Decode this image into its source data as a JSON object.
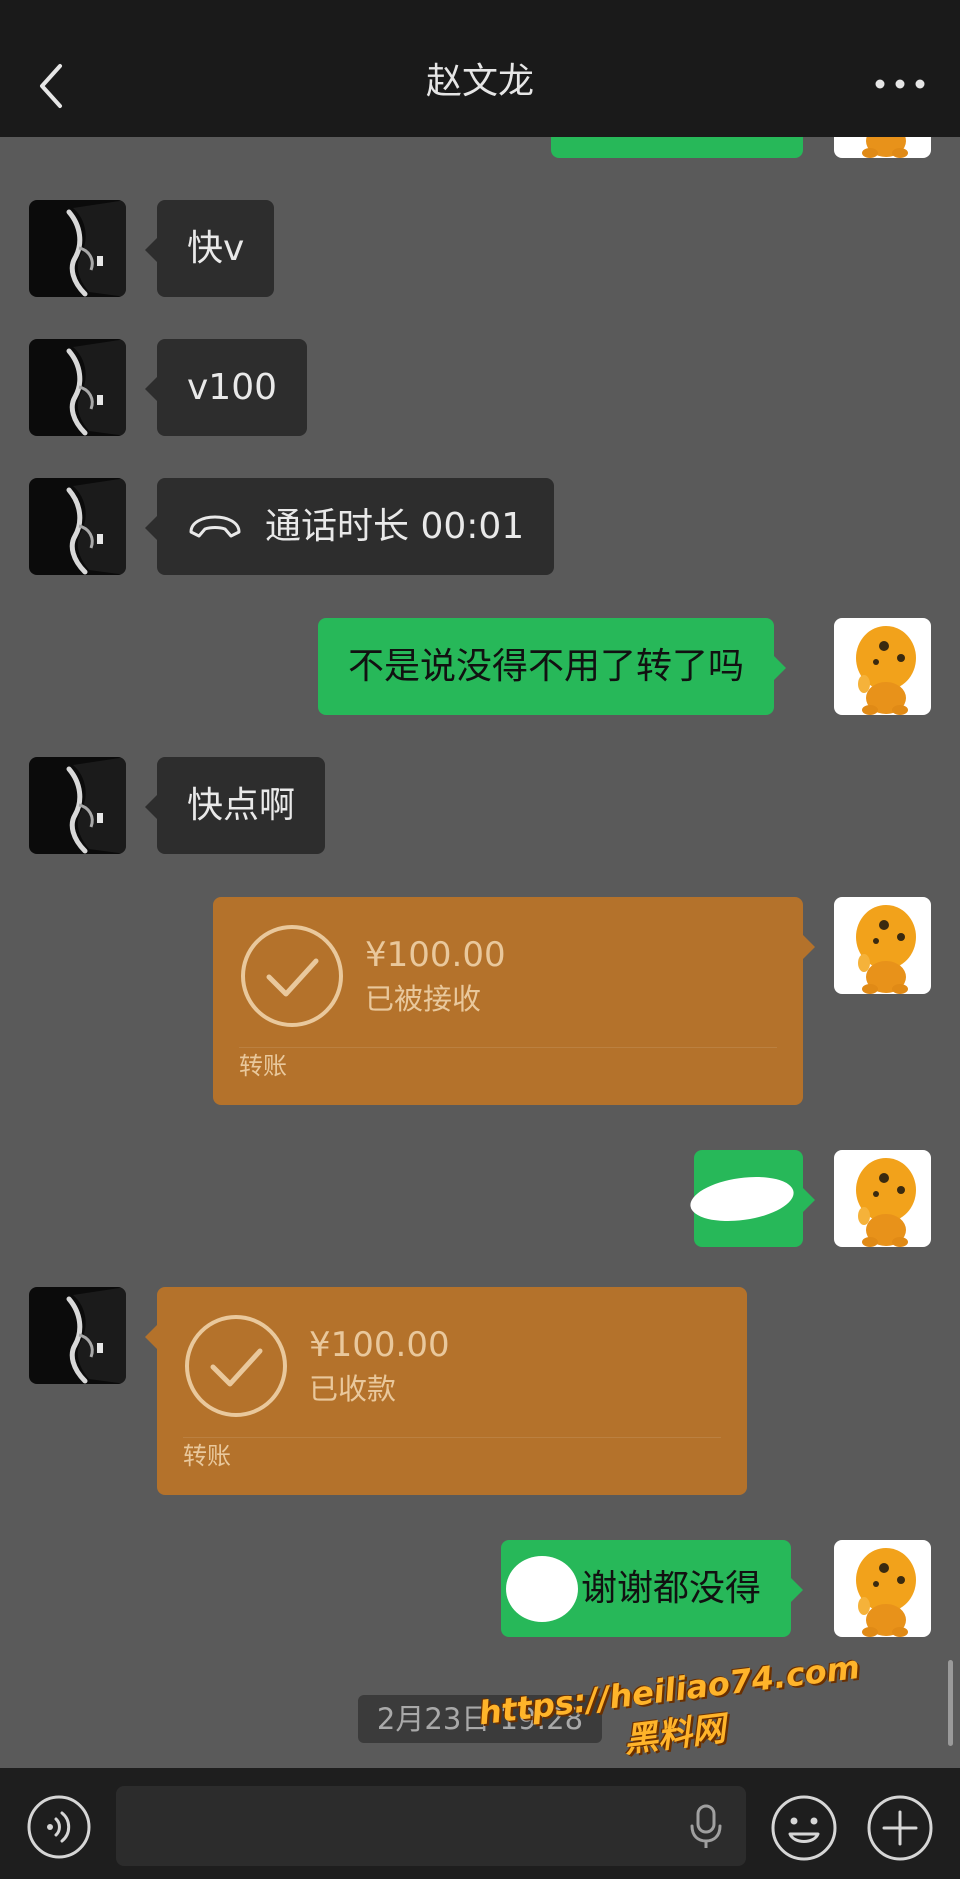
{
  "header": {
    "title": "赵文龙"
  },
  "messages": {
    "m1": "快v",
    "m2": "v100",
    "m3_call": "通话时长 00:01",
    "m4": "不是说没得不用了转了吗",
    "m5": "快点啊",
    "t1": {
      "amount": "¥100.00",
      "status": "已被接收",
      "label": "转账"
    },
    "t2": {
      "amount": "¥100.00",
      "status": "已收款",
      "label": "转账"
    },
    "m8": "谢谢都没得"
  },
  "timestamp": "2月23日 19:28",
  "watermark": {
    "url": "https://heiliao74.com",
    "cn": "黑料网"
  },
  "colors": {
    "background": "#5a5a5a",
    "incoming_bubble": "#2d2d2d",
    "outgoing_bubble": "#27b859",
    "transfer_card": "#b4722b"
  },
  "icons": {
    "back": "chevron-left-icon",
    "more": "more-dots-icon",
    "call": "phone-hangup-icon",
    "voice": "voice-wave-icon",
    "mic": "microphone-icon",
    "emoji": "smiley-icon",
    "plus": "plus-icon",
    "check": "check-circle-icon"
  }
}
